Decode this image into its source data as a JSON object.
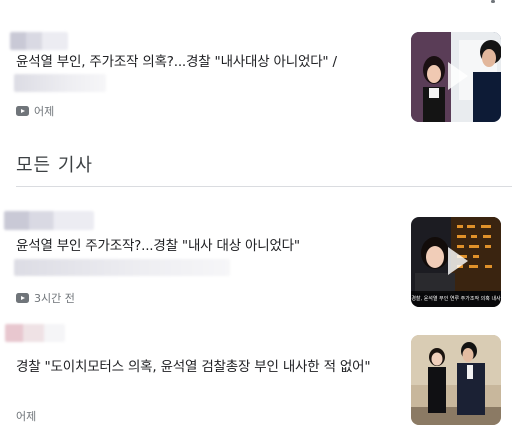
{
  "articles": [
    {
      "headline": "윤석열 부인, 주가조작 의혹?...경찰 \"내사대상 아니었다\" /",
      "time": "어제",
      "has_video": true
    },
    {
      "headline": "윤석열 부인 주가조작?...경찰 \"내사 대상 아니었다\"",
      "time": "3시간 전",
      "has_video": true,
      "thumbnail_caption": "경찰, 윤석열 부인 연루 주가조작 의혹 내사"
    },
    {
      "headline": "경찰 \"도이치모터스 의혹, 윤석열 검찰총장 부인 내사한 적 없어\"",
      "time": "어제",
      "has_video": false
    }
  ],
  "section": {
    "title": "모든 기사"
  },
  "colors": {
    "text": "#202124",
    "meta": "#70757a",
    "divider": "#dadce0"
  }
}
